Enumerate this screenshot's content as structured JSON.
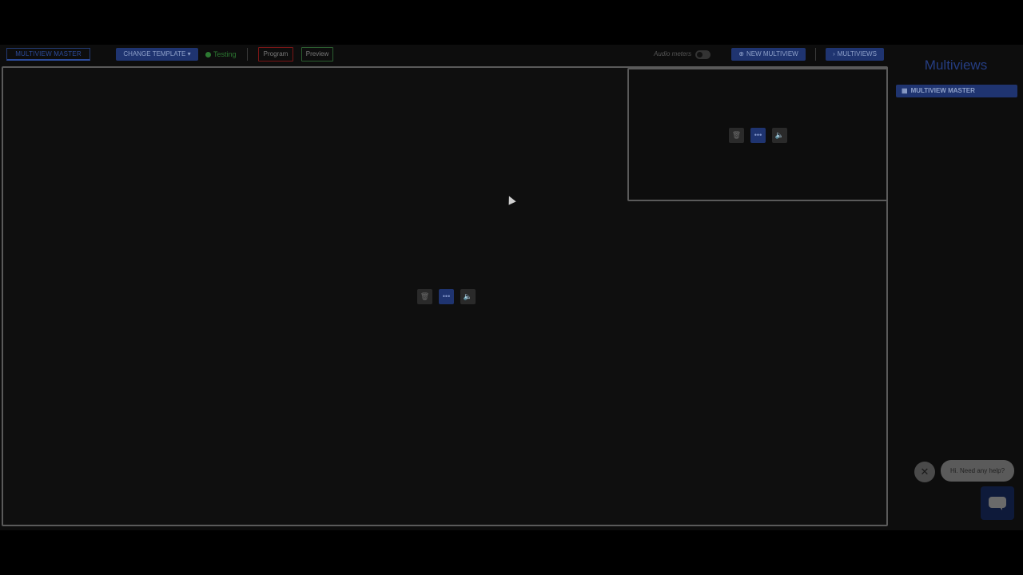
{
  "toolbar": {
    "master_tab": "MULTIVIEW MASTER",
    "change_template": "CHANGE TEMPLATE",
    "change_template_caret": "▾",
    "status": "Testing",
    "program": "Program",
    "preview": "Preview",
    "audio_label": "Audio meters",
    "new_multiview": "NEW MULTIVIEW",
    "new_multiview_icon": "⊕",
    "multiviews": "MULTIVIEWS",
    "multiviews_icon": "›"
  },
  "controls": {
    "delete_icon": "🗑",
    "menu_icon": "•••",
    "audio_icon": "🔈"
  },
  "sidebar": {
    "title": "Multiviews",
    "items": [
      {
        "label": "MULTIVIEW MASTER",
        "icon": "▦"
      }
    ]
  },
  "chat": {
    "close_icon": "✕",
    "message": "Hi. Need any help?"
  },
  "colors": {
    "accent": "#1f3470",
    "program_red": "#7a1616",
    "preview_green": "#2c5e30",
    "status_green": "#2d7a32"
  }
}
